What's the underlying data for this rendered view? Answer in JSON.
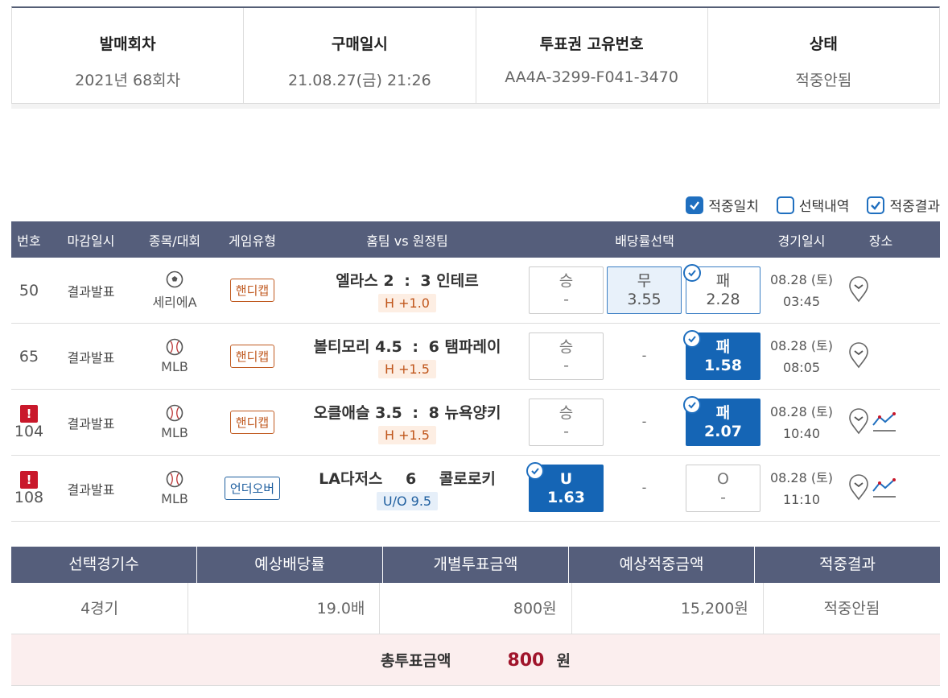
{
  "info": {
    "round_label": "발매회차",
    "round_value": "2021년 68회차",
    "purchase_label": "구매일시",
    "purchase_value": "21.08.27(금) 21:26",
    "ticket_label": "투표권 고유번호",
    "ticket_value": "AA4A-3299-F041-3470",
    "status_label": "상태",
    "status_value": "적중안됨"
  },
  "filters": [
    {
      "label": "적중일치",
      "checked": true
    },
    {
      "label": "선택내역",
      "checked": false
    },
    {
      "label": "적중결과",
      "checked": true
    }
  ],
  "games_header": {
    "no": "번호",
    "deadline": "마감일시",
    "sport": "종목/대회",
    "gametype": "게임유형",
    "match": "홈팀 vs 원정팀",
    "odds": "배당률선택",
    "date": "경기일시",
    "place": "장소"
  },
  "games": [
    {
      "no": "50",
      "deadline": "결과발표",
      "sport_icon": "soccer-ball-icon",
      "league": "세리에A",
      "game_type": "핸디캡",
      "home": "엘라스",
      "home_score": "2",
      "colon": ":",
      "away_score": "3",
      "away": "인테르",
      "handicap": "H +1.0",
      "odds": {
        "win_label": "승",
        "win_value": "-",
        "draw_label": "무",
        "draw_value": "3.55",
        "lose_label": "패",
        "lose_value": "2.28"
      },
      "date": "08.28 (토)",
      "time": "03:45"
    },
    {
      "no": "65",
      "deadline": "결과발표",
      "sport_icon": "baseball-icon",
      "league": "MLB",
      "game_type": "핸디캡",
      "home": "볼티모리",
      "home_score": "4.5",
      "colon": ":",
      "away_score": "6",
      "away": "탬파레이",
      "handicap": "H +1.5",
      "odds": {
        "win_label": "승",
        "win_value": "-",
        "draw_value": "-",
        "lose_label": "패",
        "lose_value": "1.58"
      },
      "date": "08.28 (토)",
      "time": "08:05"
    },
    {
      "no": "104",
      "deadline": "결과발표",
      "sport_icon": "baseball-icon",
      "league": "MLB",
      "game_type": "핸디캡",
      "home": "오클애슬",
      "home_score": "3.5",
      "colon": ":",
      "away_score": "8",
      "away": "뉴욕양키",
      "handicap": "H +1.5",
      "odds": {
        "win_label": "승",
        "win_value": "-",
        "draw_value": "-",
        "lose_label": "패",
        "lose_value": "2.07"
      },
      "date": "08.28 (토)",
      "time": "10:40"
    },
    {
      "no": "108",
      "deadline": "결과발표",
      "sport_icon": "baseball-icon",
      "league": "MLB",
      "game_type": "언더오버",
      "home": "LA다저스",
      "score": "6",
      "away": "콜로로키",
      "uo": "U/O 9.5",
      "odds": {
        "under_label": "U",
        "under_value": "1.63",
        "draw_value": "-",
        "over_label": "O",
        "over_value": "-"
      },
      "date": "08.28 (토)",
      "time": "11:10"
    }
  ],
  "summary": {
    "head": [
      "선택경기수",
      "예상배당률",
      "개별투표금액",
      "예상적중금액",
      "적중결과"
    ],
    "values": [
      "4경기",
      "19.0배",
      "800원",
      "15,200원",
      "적중안됨"
    ],
    "total_label": "총투표금액",
    "total_value": "800",
    "total_unit": "원"
  },
  "colors": {
    "header_bg": "#555e7b",
    "selected_blue": "#1565b5",
    "warning_red": "#c9182b",
    "total_red": "#a0142b"
  }
}
